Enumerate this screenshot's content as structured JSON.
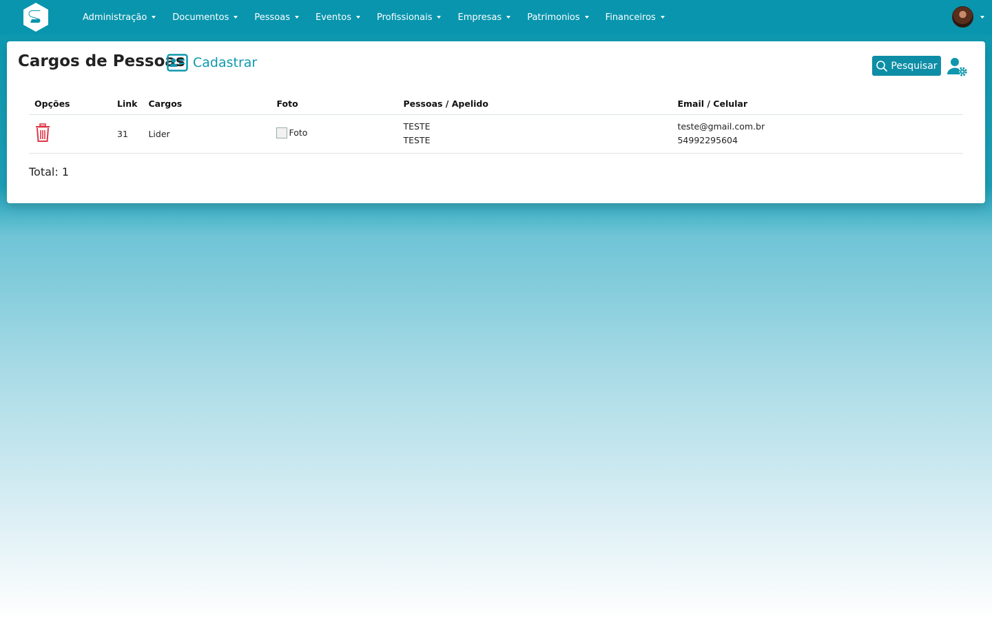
{
  "nav": {
    "items": [
      {
        "label": "Administração"
      },
      {
        "label": "Documentos"
      },
      {
        "label": "Pessoas"
      },
      {
        "label": "Eventos"
      },
      {
        "label": "Profissionais"
      },
      {
        "label": "Empresas"
      },
      {
        "label": "Patrimonios"
      },
      {
        "label": "Financeiros"
      }
    ]
  },
  "page": {
    "title": "Cargos de Pessoas",
    "cadastrar_label": "Cadastrar",
    "search_label": "Pesquisar",
    "total_label": "Total: 1"
  },
  "table": {
    "headers": {
      "options": "Opções",
      "link": "Link",
      "cargos": "Cargos",
      "foto": "Foto",
      "pessoas": "Pessoas / Apelido",
      "email": "Email / Celular"
    },
    "rows": [
      {
        "link": "31",
        "cargo": "Lider",
        "foto_alt": "Foto",
        "pessoa": "TESTE",
        "apelido": "TESTE",
        "email": "teste@gmail.com.br",
        "celular": "54992295604"
      }
    ]
  },
  "colors": {
    "navbar": "#0895ad",
    "accent": "#0e97ad",
    "danger": "#dc3545"
  },
  "icons": {
    "brand": "s-logo-icon",
    "cadastrar": "id-card-icon",
    "search": "search-icon",
    "settings": "user-gear-icon",
    "delete": "trash-icon"
  }
}
